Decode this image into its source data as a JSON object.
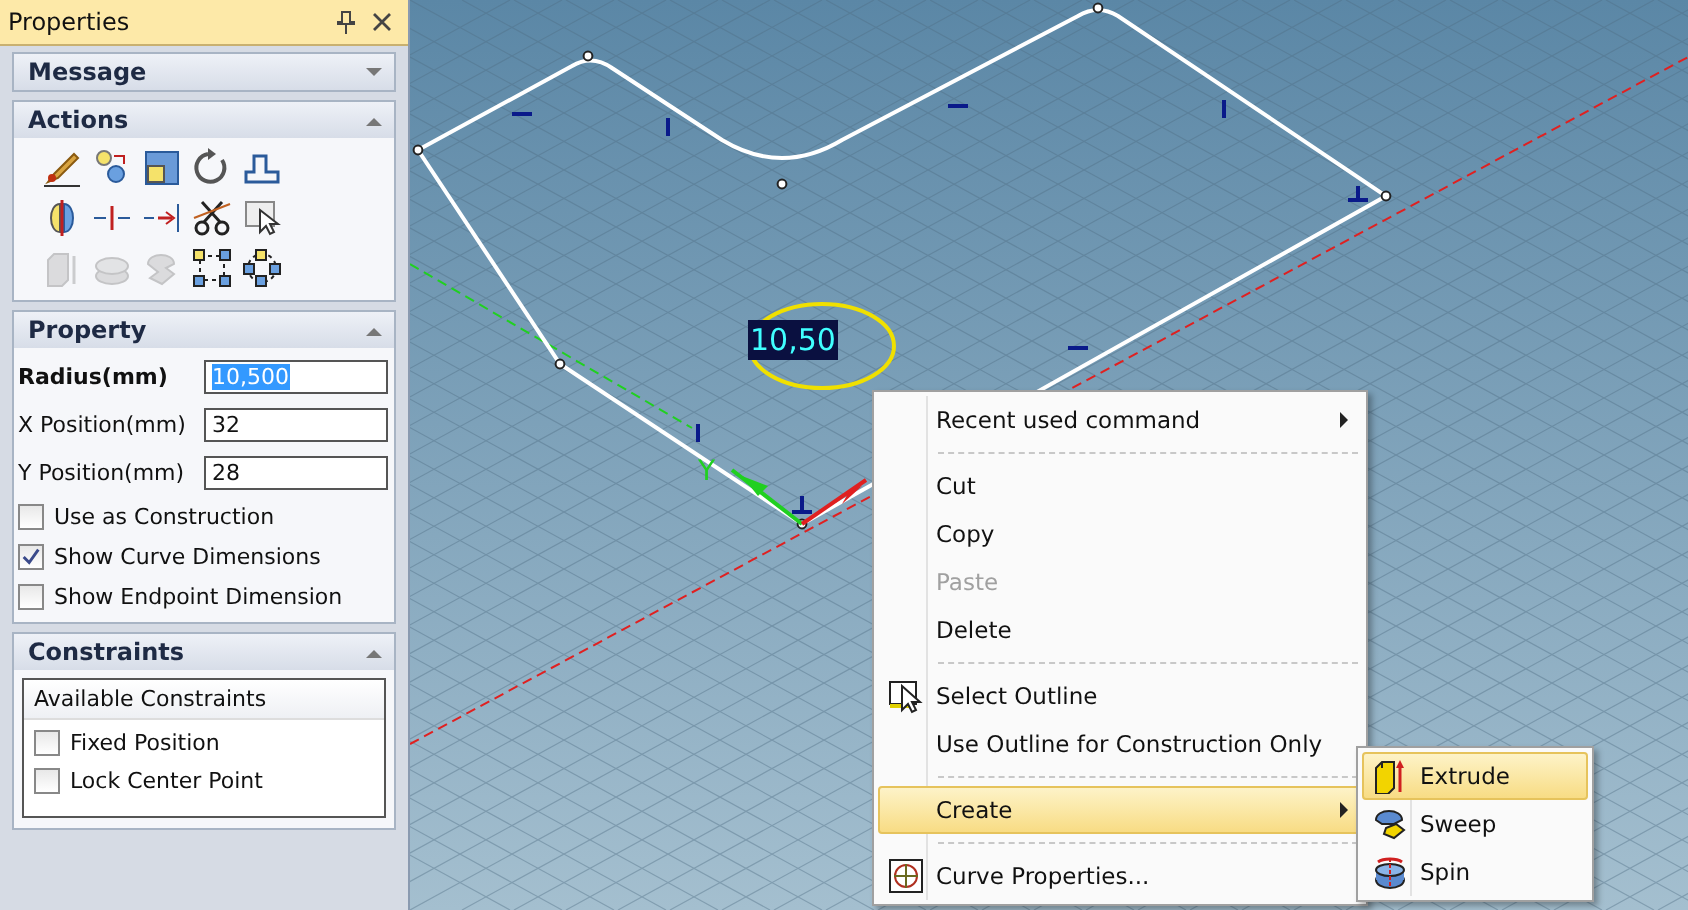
{
  "panel": {
    "title": "Properties"
  },
  "message_section": {
    "title": "Message",
    "expanded": false
  },
  "actions_section": {
    "title": "Actions",
    "expanded": true,
    "tools": [
      {
        "kind": "brush",
        "disabled": false
      },
      {
        "kind": "link",
        "disabled": false
      },
      {
        "kind": "square",
        "disabled": false
      },
      {
        "kind": "rotate",
        "disabled": false
      },
      {
        "kind": "profile",
        "disabled": false
      },
      {
        "kind": "mirror",
        "disabled": false
      },
      {
        "kind": "divide",
        "disabled": false
      },
      {
        "kind": "extend",
        "disabled": false
      },
      {
        "kind": "scissors",
        "disabled": false
      },
      {
        "kind": "pointer",
        "disabled": false
      },
      {
        "kind": "extrude",
        "disabled": true
      },
      {
        "kind": "spin",
        "disabled": true
      },
      {
        "kind": "sweep",
        "disabled": true
      },
      {
        "kind": "nodes-square",
        "disabled": false
      },
      {
        "kind": "nodes-circle",
        "disabled": false
      }
    ]
  },
  "property_section": {
    "title": "Property",
    "expanded": true,
    "fields": [
      {
        "label": "Radius(mm)",
        "value": "10,500",
        "selected": true
      },
      {
        "label": "X Position(mm)",
        "value": "32",
        "selected": false
      },
      {
        "label": "Y Position(mm)",
        "value": "28",
        "selected": false
      }
    ],
    "checkboxes": [
      {
        "label": "Use as Construction",
        "checked": false
      },
      {
        "label": "Show Curve Dimensions",
        "checked": true
      },
      {
        "label": "Show Endpoint Dimension",
        "checked": false
      }
    ]
  },
  "constraints_section": {
    "title": "Constraints",
    "expanded": true,
    "list_header": "Available Constraints",
    "items": [
      {
        "label": "Fixed Position",
        "checked": false
      },
      {
        "label": "Lock Center Point",
        "checked": false
      }
    ]
  },
  "viewport": {
    "dimension_value": "10,50",
    "axis_label": "Y"
  },
  "context_menu": [
    {
      "kind": "item",
      "label": "Recent used command",
      "submenu": true,
      "disabled": false,
      "selected": false
    },
    {
      "kind": "separator"
    },
    {
      "kind": "item",
      "label": "Cut",
      "submenu": false,
      "disabled": false,
      "selected": false
    },
    {
      "kind": "item",
      "label": "Copy",
      "submenu": false,
      "disabled": false,
      "selected": false
    },
    {
      "kind": "item",
      "label": "Paste",
      "submenu": false,
      "disabled": true,
      "selected": false
    },
    {
      "kind": "item",
      "label": "Delete",
      "submenu": false,
      "disabled": false,
      "selected": false
    },
    {
      "kind": "separator"
    },
    {
      "kind": "select",
      "label": "Select Outline",
      "submenu": false,
      "disabled": false,
      "selected": false
    },
    {
      "kind": "item",
      "label": "Use Outline for Construction Only",
      "submenu": false,
      "disabled": false,
      "selected": false
    },
    {
      "kind": "separator"
    },
    {
      "kind": "item",
      "label": "Create",
      "submenu": true,
      "disabled": false,
      "selected": true
    },
    {
      "kind": "separator"
    },
    {
      "kind": "target",
      "label": "Curve Properties...",
      "submenu": false,
      "disabled": false,
      "selected": false
    }
  ],
  "submenu": [
    {
      "label": "Extrude",
      "kind": "extrude",
      "selected": true
    },
    {
      "label": "Sweep",
      "kind": "sweep",
      "selected": false
    },
    {
      "label": "Spin",
      "kind": "spin",
      "selected": false
    }
  ]
}
